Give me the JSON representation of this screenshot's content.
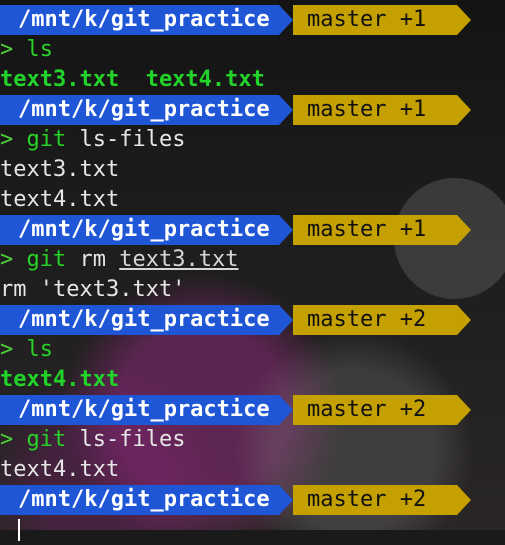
{
  "colors": {
    "path_bg": "#1f56d6",
    "git_bg": "#c4a000",
    "prompt_arrow": "#4cd137",
    "green_output": "#22d32a"
  },
  "prompt": {
    "path": "/mnt/k/git_practice",
    "arrow": ">"
  },
  "blocks": [
    {
      "git_status": "master +1",
      "command": "ls",
      "outputs": [
        "text3.txt  text4.txt"
      ],
      "output_style": "green"
    },
    {
      "git_status": "master +1",
      "command_exe": "git",
      "command_rest": "ls-files",
      "outputs": [
        "text3.txt",
        "text4.txt"
      ],
      "output_style": "white"
    },
    {
      "git_status": "master +1",
      "command_exe": "git",
      "command_rest": "rm",
      "command_arg": "text3.txt",
      "outputs": [
        "rm 'text3.txt'"
      ],
      "output_style": "white"
    },
    {
      "git_status": "master +2",
      "command": "ls",
      "outputs": [
        "text4.txt"
      ],
      "output_style": "green"
    },
    {
      "git_status": "master +2",
      "command_exe": "git",
      "command_rest": "ls-files",
      "outputs": [
        "text4.txt"
      ],
      "output_style": "white"
    },
    {
      "git_status": "master +2"
    }
  ]
}
